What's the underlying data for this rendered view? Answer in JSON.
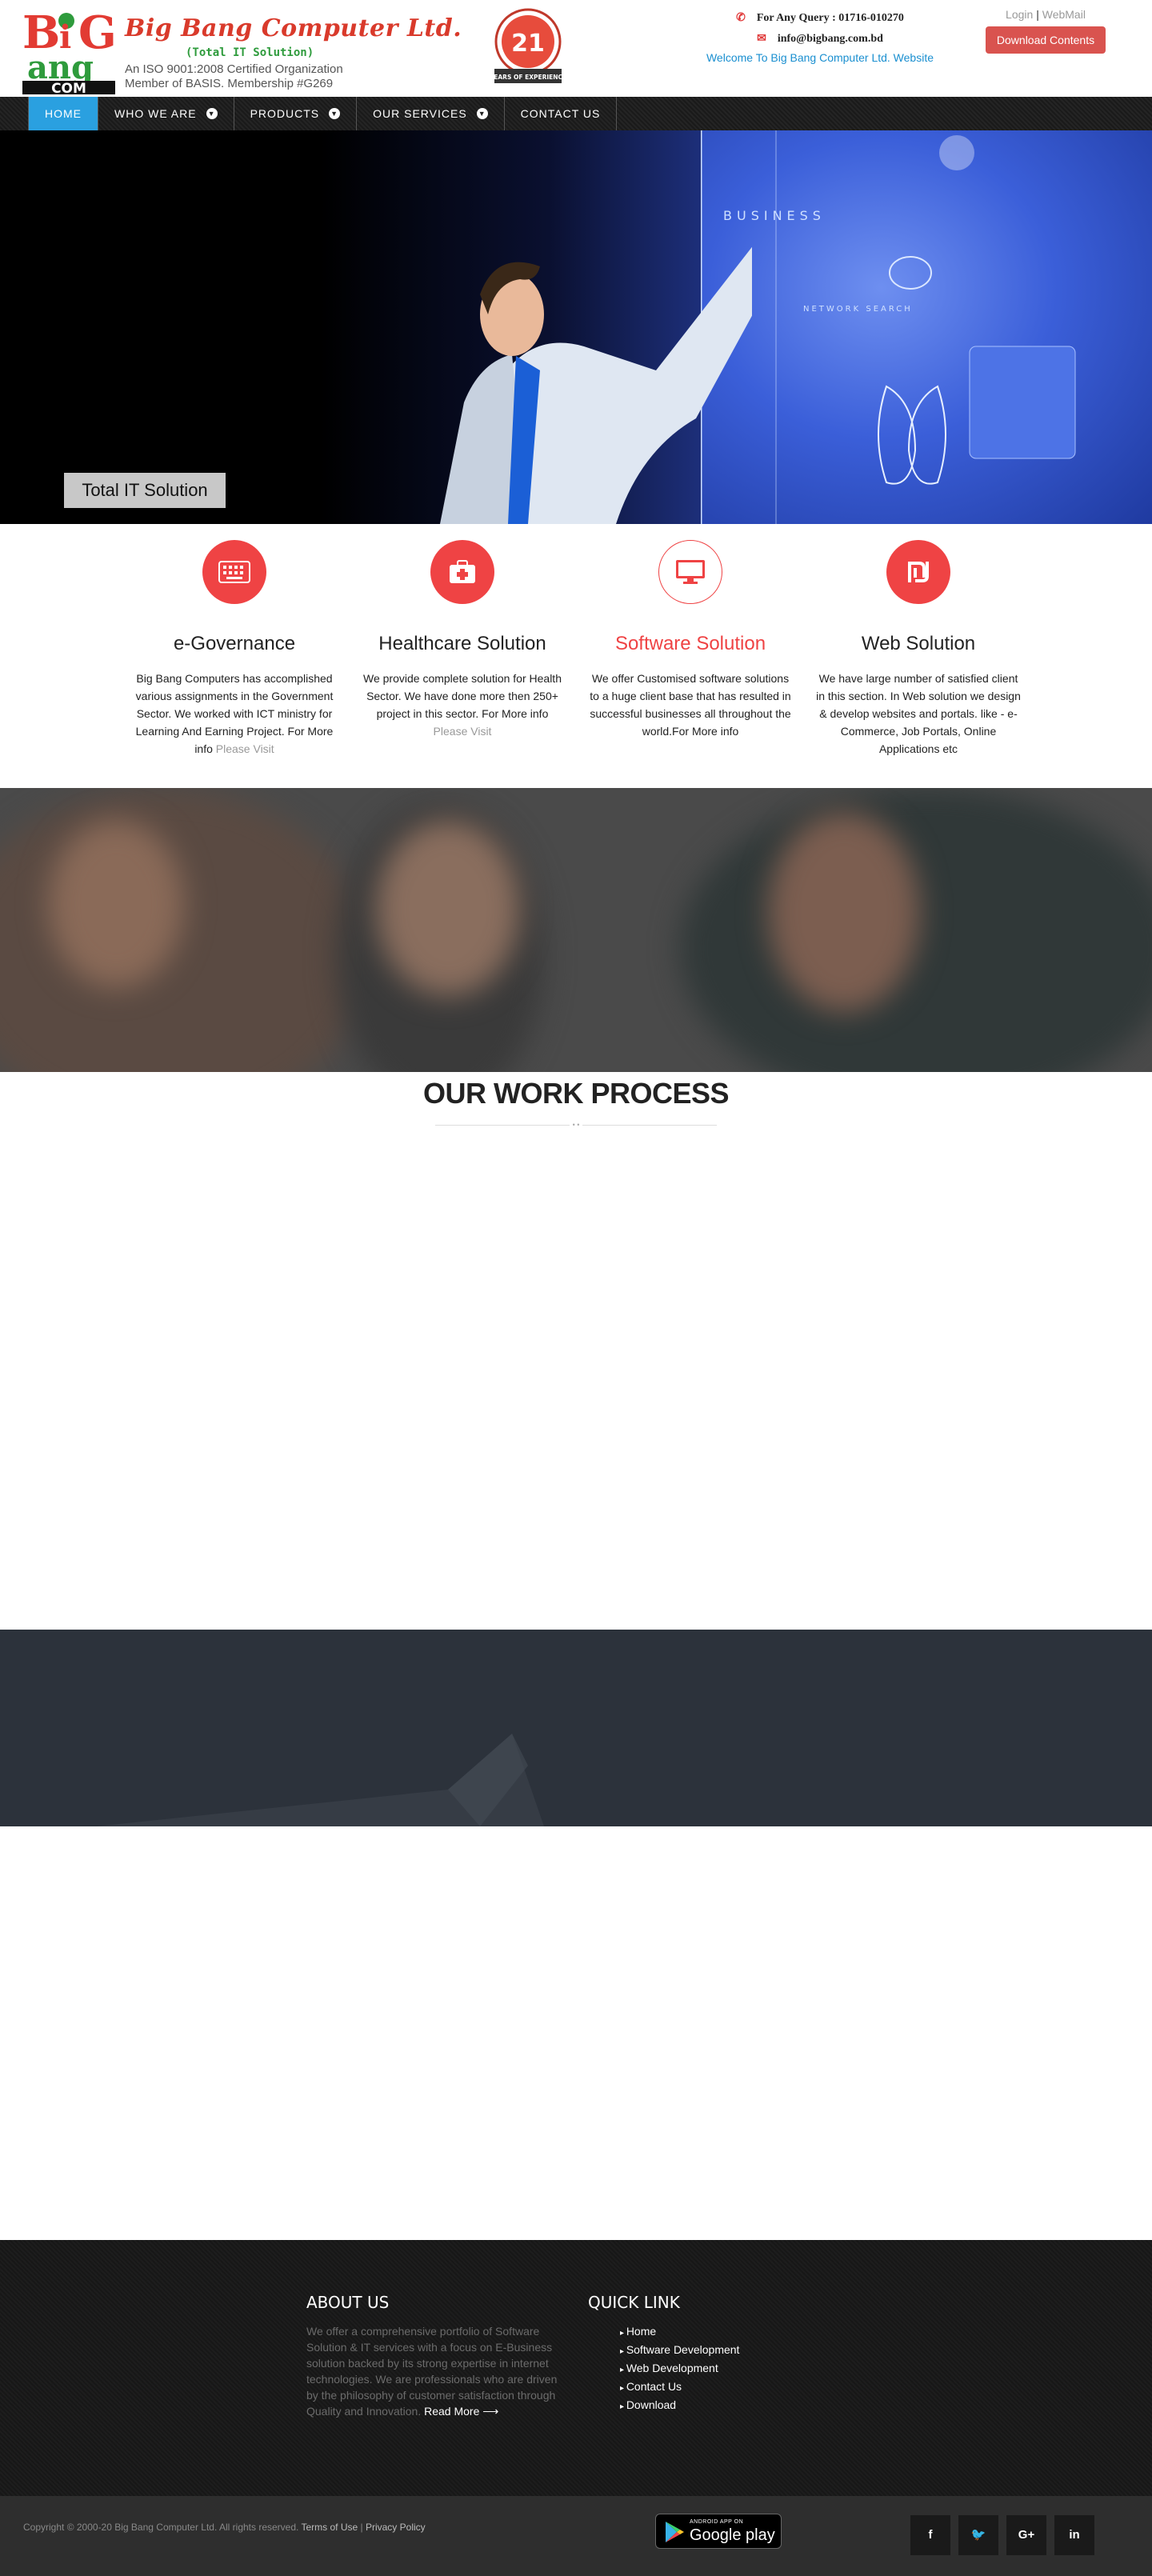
{
  "header": {
    "brand_name": "Big Bang Computer Ltd.",
    "brand_tagline": "(Total IT Solution)",
    "brand_cert_line1": "An ISO 9001:2008 Certified Organization",
    "brand_cert_line2": "Member of BASIS. Membership #G269",
    "logo_letters": {
      "b": "B",
      "i": "i",
      "g": "G",
      "ang": "ang",
      "com": "COM"
    },
    "badge": {
      "number": "21",
      "caption": "YEARS OF EXPERIENCE"
    },
    "contact": {
      "query": "For Any Query : 01716-010270",
      "email": "info@bigbang.com.bd",
      "welcome": "Welcome To Big Bang Computer Ltd. Website"
    },
    "auth": {
      "login": "Login",
      "separator": "|",
      "webmail": "WebMail"
    },
    "download_button": "Download Contents"
  },
  "nav": {
    "items": [
      {
        "label": "HOME",
        "active": true
      },
      {
        "label": "WHO WE ARE",
        "dropdown": true
      },
      {
        "label": "PRODUCTS",
        "dropdown": true
      },
      {
        "label": "OUR SERVICES",
        "dropdown": true
      },
      {
        "label": "CONTACT US"
      }
    ]
  },
  "hero": {
    "caption": "Total IT Solution",
    "screen_labels": {
      "business": "BUSINESS",
      "network": "NETWORK SEARCH"
    }
  },
  "services": [
    {
      "icon": "keyboard-icon",
      "title": "e-Governance",
      "text": "Big Bang Computers has accomplished various assignments in the Government Sector. We worked with ICT ministry for Learning And Earning Project. For More info ",
      "visit": "Please Visit"
    },
    {
      "icon": "first-aid-kit-icon",
      "title": "Healthcare Solution",
      "text": "We provide complete solution for Health Sector. We have done more then 250+ project in this sector. For More info ",
      "visit": "Please Visit"
    },
    {
      "icon": "monitor-icon",
      "title": "Software Solution",
      "text": "We offer Customised software solutions to a huge client base that has resulted in successful businesses all throughout the world.For More info",
      "visit": ""
    },
    {
      "icon": "shekel-sign-icon",
      "title": "Web Solution",
      "text": "We have large number of satisfied client in this section. In Web solution we design & develop websites and portals. like - e-Commerce, Job Portals, Online Applications etc",
      "visit": ""
    }
  ],
  "work_process": {
    "title_bold": "OUR WORK",
    "title_light": "PROCESS",
    "divider_glyph": "• •"
  },
  "footer": {
    "about_title": "ABOUT US",
    "about_text": "We offer a comprehensive portfolio of Software Solution & IT services with a focus on E-Business solution backed by its strong expertise in internet technologies.  We are professionals who are driven by the philosophy of customer satisfaction through Quality and Innovation.",
    "read_more": "Read More ⟶",
    "links_title": "QUICK LINK",
    "links": [
      "Home",
      "Software Development",
      "Web Development",
      "Contact Us",
      "Download"
    ]
  },
  "bottom": {
    "copyright": "Copyright © 2000-20 Big Bang Computer Ltd. All rights reserved. ",
    "terms": "Terms of Use",
    "separator": " | ",
    "privacy": "Privacy Policy",
    "gplay_small": "ANDROID APP ON",
    "gplay_big": "Google play",
    "social": [
      {
        "name": "facebook-icon",
        "glyph": "f"
      },
      {
        "name": "twitter-icon",
        "glyph": "🐦"
      },
      {
        "name": "google-plus-icon",
        "glyph": "G+"
      },
      {
        "name": "linkedin-icon",
        "glyph": "in"
      }
    ]
  },
  "colors": {
    "accent_red": "#ef4344",
    "nav_active": "#2aa0e0",
    "footer_bg": "#1a1a1a"
  }
}
